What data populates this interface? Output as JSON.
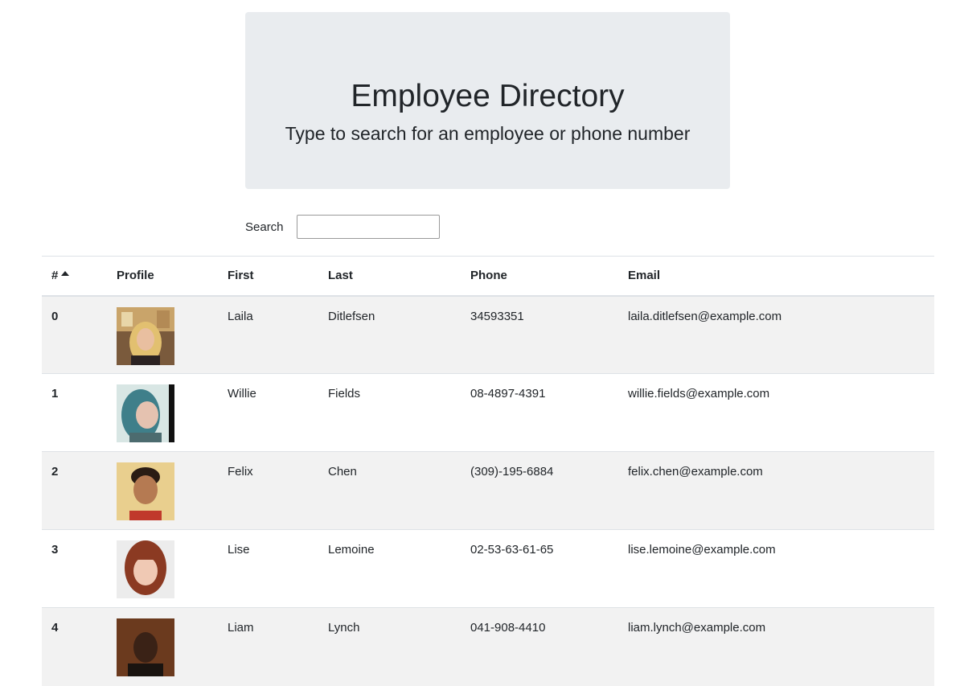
{
  "header": {
    "title": "Employee Directory",
    "subtitle": "Type to search for an employee or phone number"
  },
  "search": {
    "label": "Search",
    "value": "",
    "placeholder": ""
  },
  "table": {
    "columns": [
      "#",
      "Profile",
      "First",
      "Last",
      "Phone",
      "Email"
    ],
    "sort": {
      "column": "#",
      "direction": "ascending",
      "icon": "sort-up-icon"
    },
    "rows": [
      {
        "id": "0",
        "first": "Laila",
        "last": "Ditlefsen",
        "phone": "34593351",
        "email": "laila.ditlefsen@example.com",
        "avatar": "avatar-laila"
      },
      {
        "id": "1",
        "first": "Willie",
        "last": "Fields",
        "phone": "08-4897-4391",
        "email": "willie.fields@example.com",
        "avatar": "avatar-willie"
      },
      {
        "id": "2",
        "first": "Felix",
        "last": "Chen",
        "phone": "(309)-195-6884",
        "email": "felix.chen@example.com",
        "avatar": "avatar-felix"
      },
      {
        "id": "3",
        "first": "Lise",
        "last": "Lemoine",
        "phone": "02-53-63-61-65",
        "email": "lise.lemoine@example.com",
        "avatar": "avatar-lise"
      },
      {
        "id": "4",
        "first": "Liam",
        "last": "Lynch",
        "phone": "041-908-4410",
        "email": "liam.lynch@example.com",
        "avatar": "avatar-liam"
      }
    ]
  },
  "colors": {
    "jumbotron_bg": "#e9ecef",
    "stripe_bg": "#f2f2f2",
    "border": "#dee2e6",
    "text": "#212529"
  }
}
